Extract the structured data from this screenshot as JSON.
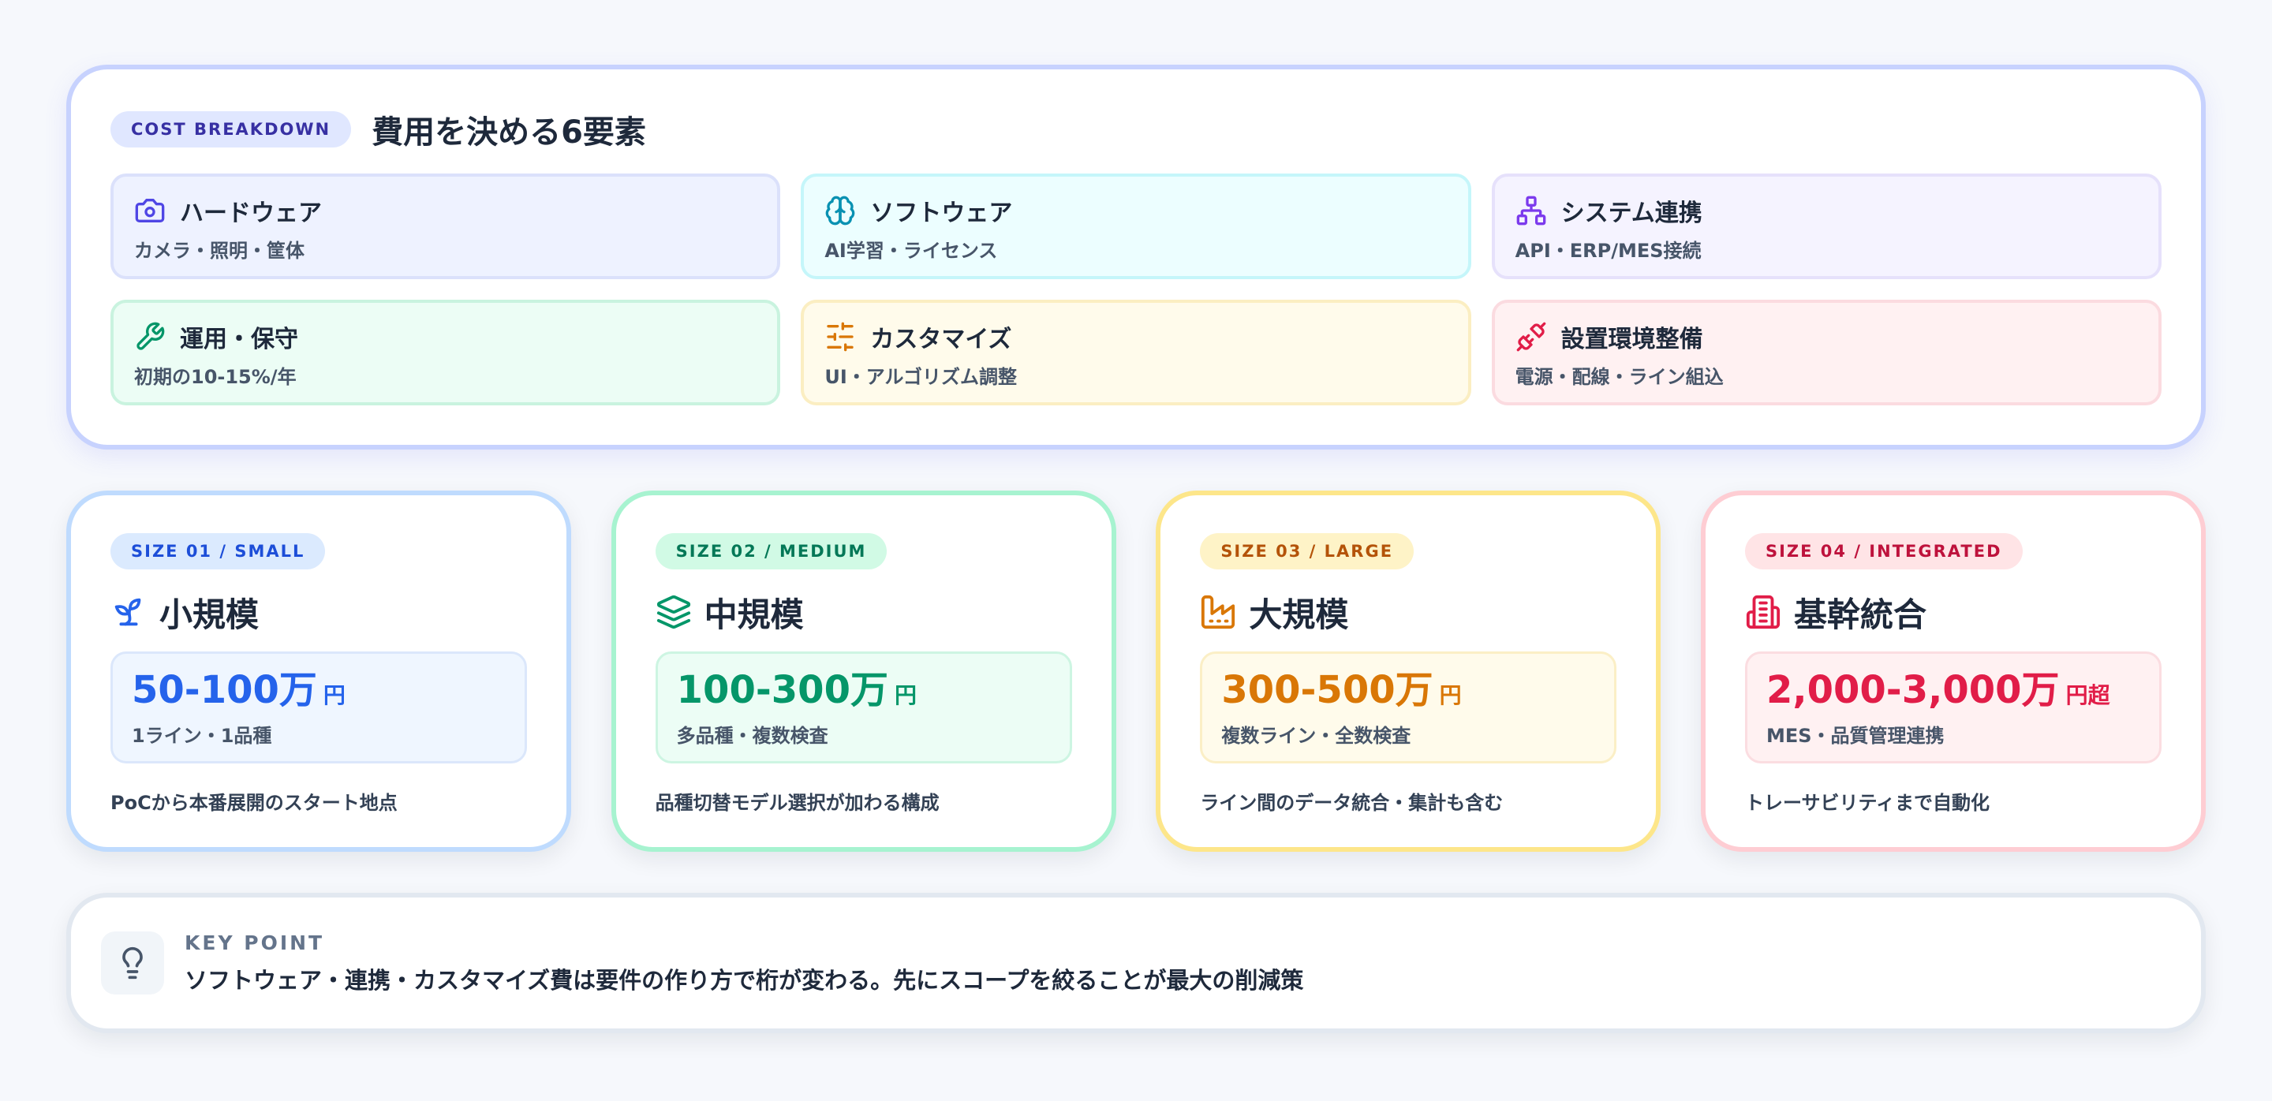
{
  "breakdown": {
    "badge": "COST BREAKDOWN",
    "title": "費用を決める6要素",
    "factors": [
      {
        "icon": "camera-icon",
        "name": "ハードウェア",
        "sub": "カメラ・照明・筐体",
        "color": "#4f46e5",
        "bg": "#eef2ff",
        "border": "#dbe1fb"
      },
      {
        "icon": "brain-icon",
        "name": "ソフトウェア",
        "sub": "AI学習・ライセンス",
        "color": "#0891b2",
        "bg": "#ecfeff",
        "border": "#c5f6fa"
      },
      {
        "icon": "network-icon",
        "name": "システム連携",
        "sub": "API・ERP/MES接続",
        "color": "#7c3aed",
        "bg": "#f5f3ff",
        "border": "#e6e1fb"
      },
      {
        "icon": "wrench-icon",
        "name": "運用・保守",
        "sub": "初期の10-15%/年",
        "color": "#059669",
        "bg": "#ecfdf5",
        "border": "#c9f3df"
      },
      {
        "icon": "sliders-icon",
        "name": "カスタマイズ",
        "sub": "UI・アルゴリズム調整",
        "color": "#d97706",
        "bg": "#fffbeb",
        "border": "#fbeec2"
      },
      {
        "icon": "plug-icon",
        "name": "設置環境整備",
        "sub": "電源・配線・ライン組込",
        "color": "#e11d48",
        "bg": "#fff1f2",
        "border": "#fbdbe0"
      }
    ]
  },
  "sizes": [
    {
      "badge": "SIZE 01 / SMALL",
      "icon": "sprout-icon",
      "name": "小規模",
      "price": "50-100万",
      "unit": "円",
      "note": "1ライン・1品種",
      "desc": "PoCから本番展開のスタート地点",
      "accent": "#2563eb",
      "border": "#bfdbfe",
      "badge_bg": "#dbeafe",
      "badge_fg": "#1d4ed8",
      "box_bg": "#eff6ff",
      "box_border": "#dbe7fb"
    },
    {
      "badge": "SIZE 02 / MEDIUM",
      "icon": "layers-icon",
      "name": "中規模",
      "price": "100-300万",
      "unit": "円",
      "note": "多品種・複数検査",
      "desc": "品種切替モデル選択が加わる構成",
      "accent": "#059669",
      "border": "#a7f3d0",
      "badge_bg": "#d1fae5",
      "badge_fg": "#047857",
      "box_bg": "#ecfdf5",
      "box_border": "#cdf5e2"
    },
    {
      "badge": "SIZE 03 / LARGE",
      "icon": "factory-icon",
      "name": "大規模",
      "price": "300-500万",
      "unit": "円",
      "note": "複数ライン・全数検査",
      "desc": "ライン間のデータ統合・集計も含む",
      "accent": "#d97706",
      "border": "#fde68a",
      "badge_bg": "#fef3c7",
      "badge_fg": "#b45309",
      "box_bg": "#fffbeb",
      "box_border": "#fbefc6"
    },
    {
      "badge": "SIZE 04 / INTEGRATED",
      "icon": "building-icon",
      "name": "基幹統合",
      "price": "2,000-3,000万",
      "unit": "円超",
      "note": "MES・品質管理連携",
      "desc": "トレーサビリティまで自動化",
      "accent": "#e11d48",
      "border": "#fecdd3",
      "badge_bg": "#ffe4e6",
      "badge_fg": "#be123c",
      "box_bg": "#fff1f2",
      "box_border": "#fbdde1"
    }
  ],
  "key": {
    "icon": "lightbulb-icon",
    "label": "KEY POINT",
    "text": "ソフトウェア・連携・カスタマイズ費は要件の作り方で桁が変わる。先にスコープを絞ることが最大の削減策"
  }
}
